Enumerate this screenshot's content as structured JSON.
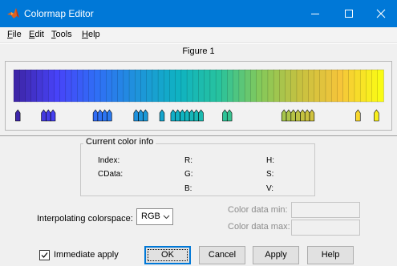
{
  "window": {
    "title": "Colormap Editor",
    "app_icon": "matlab-logo-icon",
    "controls": [
      "minimize-icon",
      "maximize-icon",
      "close-icon"
    ]
  },
  "menu": {
    "items": [
      {
        "label": "File",
        "mnemonic": "F"
      },
      {
        "label": "Edit",
        "mnemonic": "E"
      },
      {
        "label": "Tools",
        "mnemonic": "T"
      },
      {
        "label": "Help",
        "mnemonic": "H"
      }
    ]
  },
  "figure": {
    "title": "Figure 1",
    "colormap": "parula",
    "colormap_stops": [
      "#3e26a8",
      "#4743f8",
      "#2f6ff5",
      "#1e94da",
      "#0fb2c2",
      "#27c29e",
      "#82c95b",
      "#c6c140",
      "#f6c53a",
      "#f9fb15"
    ],
    "marker_groups": [
      {
        "start": 0.005,
        "count": 1
      },
      {
        "start": 0.075,
        "count": 3
      },
      {
        "start": 0.215,
        "count": 4
      },
      {
        "start": 0.325,
        "count": 3
      },
      {
        "start": 0.395,
        "count": 1
      },
      {
        "start": 0.425,
        "count": 7
      },
      {
        "start": 0.565,
        "count": 2
      },
      {
        "start": 0.725,
        "count": 7
      },
      {
        "start": 0.925,
        "count": 1
      },
      {
        "start": 0.975,
        "count": 1
      }
    ]
  },
  "current_color_info": {
    "title": "Current color info",
    "index_label": "Index:",
    "cdata_label": "CData:",
    "r_label": "R:",
    "g_label": "G:",
    "b_label": "B:",
    "h_label": "H:",
    "s_label": "S:",
    "v_label": "V:"
  },
  "interpolation": {
    "label": "Interpolating colorspace:",
    "value": "RGB"
  },
  "color_data": {
    "min_label": "Color data min:",
    "max_label": "Color data max:",
    "min_value": "",
    "max_value": ""
  },
  "immediate_apply": {
    "label": "Immediate apply",
    "checked": true
  },
  "buttons": {
    "ok": "OK",
    "cancel": "Cancel",
    "apply": "Apply",
    "help": "Help"
  }
}
